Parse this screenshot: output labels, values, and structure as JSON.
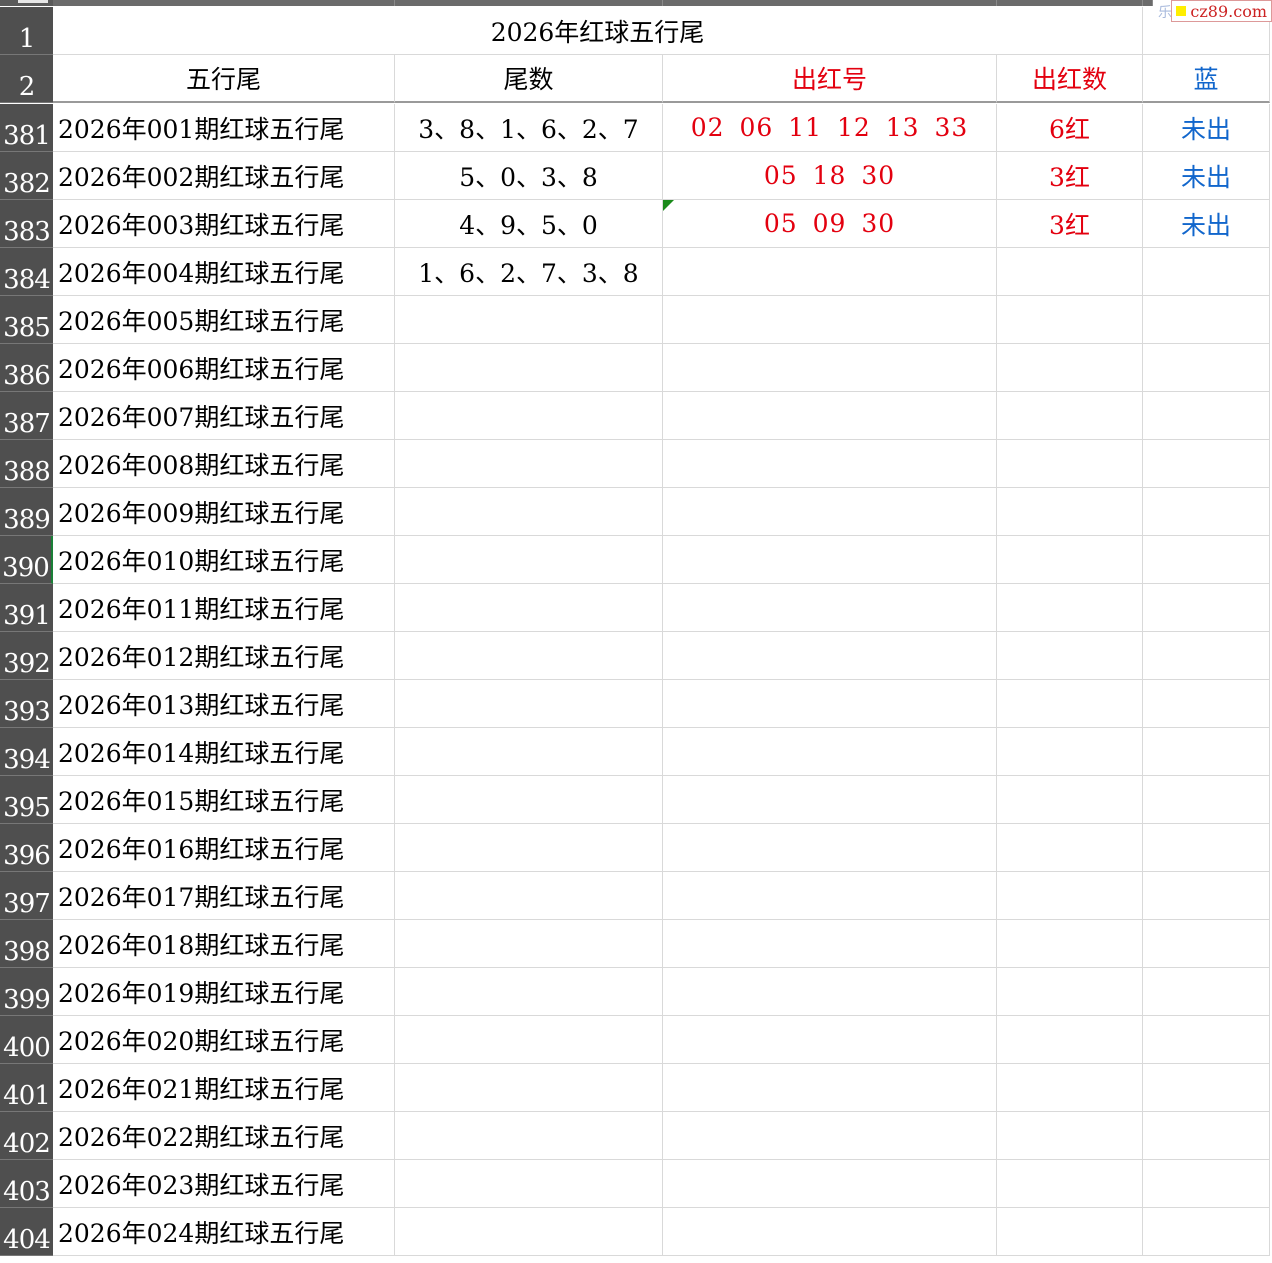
{
  "watermark": {
    "text": "cz89.com",
    "ghost": "乐"
  },
  "title_row": {
    "row_number": "1",
    "title": "2026年红球五行尾"
  },
  "header_row": {
    "row_number": "2",
    "columns": [
      "五行尾",
      "尾数",
      "出红号",
      "出红数",
      "蓝"
    ]
  },
  "rows": [
    {
      "num": "381",
      "name": "2026年001期红球五行尾",
      "tails": "3、8、1、6、2、7",
      "reds": "02  06  11  12  13  33",
      "count": "6红",
      "blue": "未出"
    },
    {
      "num": "382",
      "name": "2026年002期红球五行尾",
      "tails": "5、0、3、8",
      "reds": "05  18  30",
      "count": "3红",
      "blue": "未出"
    },
    {
      "num": "383",
      "name": "2026年003期红球五行尾",
      "tails": "4、9、5、0",
      "reds": "05  09  30",
      "count": "3红",
      "blue": "未出"
    },
    {
      "num": "384",
      "name": "2026年004期红球五行尾",
      "tails": "1、6、2、7、3、8",
      "reds": "",
      "count": "",
      "blue": ""
    },
    {
      "num": "385",
      "name": "2026年005期红球五行尾",
      "tails": "",
      "reds": "",
      "count": "",
      "blue": ""
    },
    {
      "num": "386",
      "name": "2026年006期红球五行尾",
      "tails": "",
      "reds": "",
      "count": "",
      "blue": ""
    },
    {
      "num": "387",
      "name": "2026年007期红球五行尾",
      "tails": "",
      "reds": "",
      "count": "",
      "blue": ""
    },
    {
      "num": "388",
      "name": "2026年008期红球五行尾",
      "tails": "",
      "reds": "",
      "count": "",
      "blue": ""
    },
    {
      "num": "389",
      "name": "2026年009期红球五行尾",
      "tails": "",
      "reds": "",
      "count": "",
      "blue": ""
    },
    {
      "num": "390",
      "name": "2026年010期红球五行尾",
      "tails": "",
      "reds": "",
      "count": "",
      "blue": ""
    },
    {
      "num": "391",
      "name": "2026年011期红球五行尾",
      "tails": "",
      "reds": "",
      "count": "",
      "blue": ""
    },
    {
      "num": "392",
      "name": "2026年012期红球五行尾",
      "tails": "",
      "reds": "",
      "count": "",
      "blue": ""
    },
    {
      "num": "393",
      "name": "2026年013期红球五行尾",
      "tails": "",
      "reds": "",
      "count": "",
      "blue": ""
    },
    {
      "num": "394",
      "name": "2026年014期红球五行尾",
      "tails": "",
      "reds": "",
      "count": "",
      "blue": ""
    },
    {
      "num": "395",
      "name": "2026年015期红球五行尾",
      "tails": "",
      "reds": "",
      "count": "",
      "blue": ""
    },
    {
      "num": "396",
      "name": "2026年016期红球五行尾",
      "tails": "",
      "reds": "",
      "count": "",
      "blue": ""
    },
    {
      "num": "397",
      "name": "2026年017期红球五行尾",
      "tails": "",
      "reds": "",
      "count": "",
      "blue": ""
    },
    {
      "num": "398",
      "name": "2026年018期红球五行尾",
      "tails": "",
      "reds": "",
      "count": "",
      "blue": ""
    },
    {
      "num": "399",
      "name": "2026年019期红球五行尾",
      "tails": "",
      "reds": "",
      "count": "",
      "blue": ""
    },
    {
      "num": "400",
      "name": "2026年020期红球五行尾",
      "tails": "",
      "reds": "",
      "count": "",
      "blue": ""
    },
    {
      "num": "401",
      "name": "2026年021期红球五行尾",
      "tails": "",
      "reds": "",
      "count": "",
      "blue": ""
    },
    {
      "num": "402",
      "name": "2026年022期红球五行尾",
      "tails": "",
      "reds": "",
      "count": "",
      "blue": ""
    },
    {
      "num": "403",
      "name": "2026年023期红球五行尾",
      "tails": "",
      "reds": "",
      "count": "",
      "blue": ""
    },
    {
      "num": "404",
      "name": "2026年024期红球五行尾",
      "tails": "",
      "reds": "",
      "count": "",
      "blue": ""
    }
  ],
  "active_row": "390",
  "colors": {
    "red": "#e3000f",
    "blue": "#1166cc",
    "row_header_bg": "#4f4f4f"
  }
}
